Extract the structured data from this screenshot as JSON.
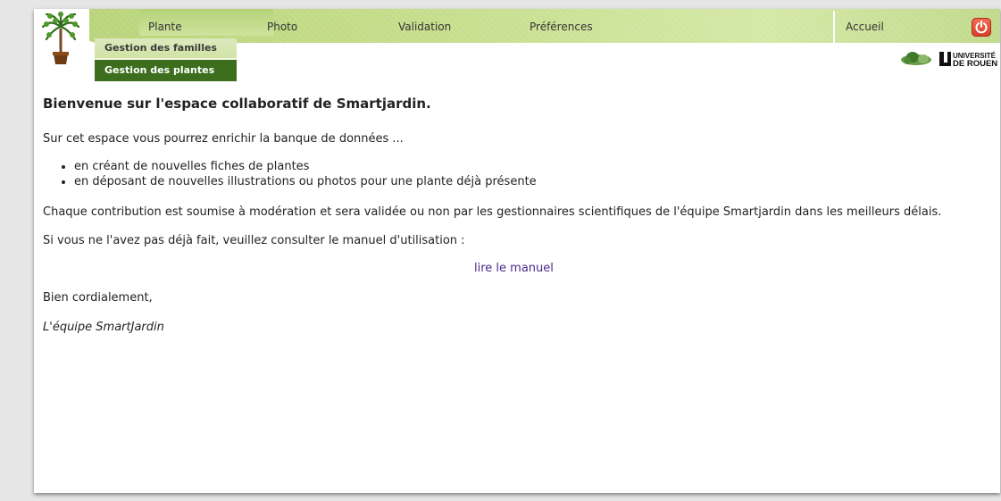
{
  "nav": {
    "items": [
      {
        "label": "Plante"
      },
      {
        "label": "Photo"
      },
      {
        "label": "Validation"
      },
      {
        "label": "Préférences"
      }
    ],
    "right_label": "Accueil",
    "power_color": "#d83b24"
  },
  "dropdown": {
    "items": [
      {
        "label": "Gestion des familles"
      },
      {
        "label": "Gestion des plantes"
      }
    ]
  },
  "logos": {
    "university_line1": "UNIVERSITÉ",
    "university_line2": "DE ROUEN",
    "icons": [
      "tree-icon",
      "espe-logo",
      "universite-rouen-logo",
      "power-icon"
    ]
  },
  "content": {
    "title": "Bienvenue sur l'espace collaboratif de Smartjardin.",
    "intro": "Sur cet espace vous pourrez enrichir la banque de données ...",
    "bullets": [
      "en créant de nouvelles fiches de plantes",
      "en déposant de nouvelles illustrations ou photos pour une plante déjà présente"
    ],
    "moderation": "Chaque contribution est soumise à modération et sera validée ou non par les gestionnaires scientifiques de l'équipe Smartjardin dans les meilleurs délais.",
    "manual_prompt": "Si vous ne l'avez pas déjà fait, veuillez consulter le manuel d'utilisation :",
    "manual_link": "lire le manuel",
    "closing": "Bien cordialement,",
    "signature": "L'équipe SmartJardin"
  },
  "colors": {
    "nav_green": "#c6de8c",
    "dropdown_dark": "#3c6e1e",
    "link": "#4a2a8a"
  }
}
